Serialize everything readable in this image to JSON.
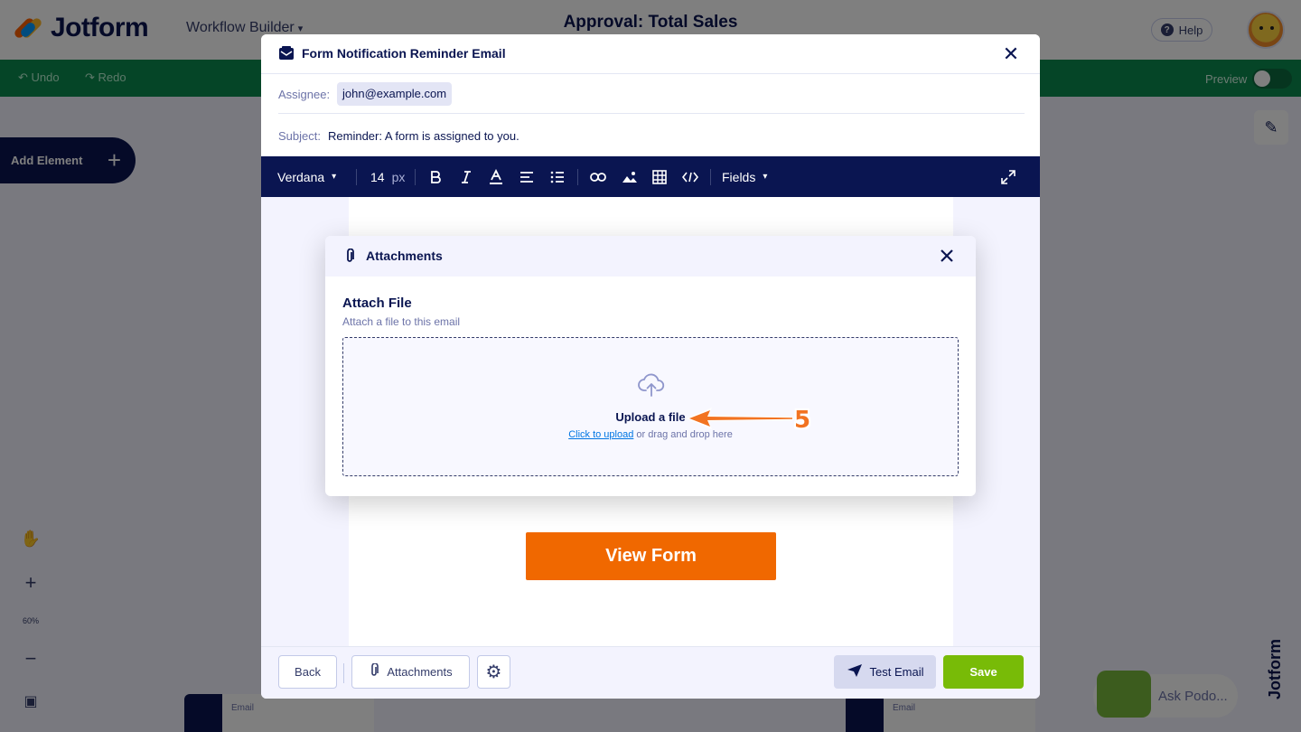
{
  "app": {
    "brand": "Jotform",
    "section": "Workflow Builder",
    "page_title": "Approval: Total Sales",
    "help_label": "Help",
    "undo_label": "Undo",
    "redo_label": "Redo",
    "preview_label": "Preview",
    "add_element_label": "Add Element",
    "zoom_level": "60%",
    "workflow_cards": [
      {
        "type": "Email",
        "sub": "Email"
      },
      {
        "type": "Email",
        "sub": "Email"
      }
    ],
    "ask_podo_label": "Ask Podo...",
    "brand_colors": {
      "green": "#0a8a4e",
      "navy": "#0a1551",
      "orange": "#f06800"
    }
  },
  "email_modal": {
    "title": "Form Notification Reminder Email",
    "assignee_label": "Assignee:",
    "assignee_value": "john@example.com",
    "subject_label": "Subject:",
    "subject_value": "Reminder: A form is assigned to you.",
    "toolbar": {
      "font_family": "Verdana",
      "font_size": "14",
      "font_unit": "px",
      "fields_label": "Fields",
      "icons": [
        "bold-icon",
        "italic-icon",
        "font-color-icon",
        "align-icon",
        "list-icon",
        "link-icon",
        "image-icon",
        "table-icon",
        "code-icon",
        "fullscreen-icon"
      ]
    },
    "body_button": "View Form",
    "footer": {
      "back_label": "Back",
      "attachments_label": "Attachments",
      "test_email_label": "Test Email",
      "save_label": "Save"
    }
  },
  "attachments_dialog": {
    "title": "Attachments",
    "heading": "Attach File",
    "subheading": "Attach a file to this email",
    "upload_title": "Upload a file",
    "click_to_upload": "Click to upload",
    "drag_drop_text": " or drag and drop here"
  },
  "annotation": {
    "step_number": "5",
    "color": "#f27321"
  }
}
